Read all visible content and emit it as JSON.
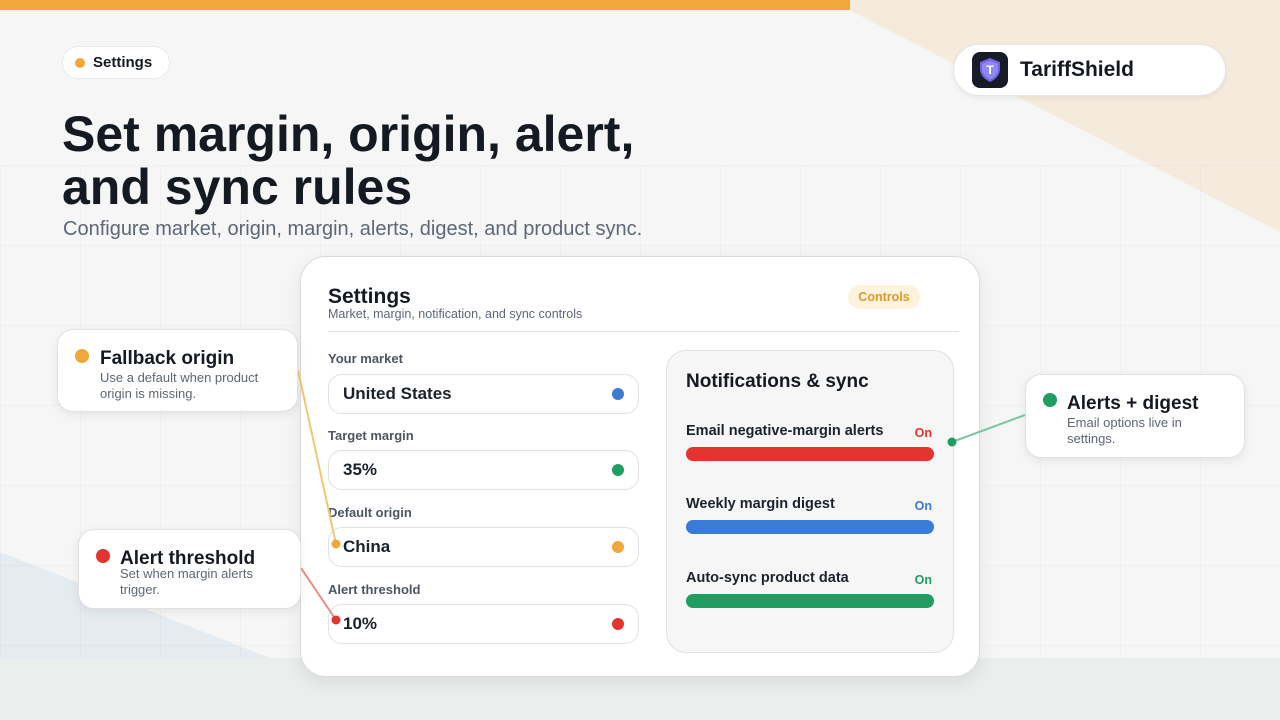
{
  "colors": {
    "accent_orange": "#f0a83a",
    "red": "#e3342f",
    "blue": "#3a7bd5",
    "green": "#1f9e63",
    "navy": "#161b26"
  },
  "tag": {
    "label": "Settings",
    "icon": "orange-dot-icon"
  },
  "brand": {
    "name": "TariffShield",
    "logo_icon": "shield-t-logo-icon",
    "logo_letter": "T"
  },
  "headline": {
    "line1": "Set margin, origin, alert,",
    "line2": "and sync rules"
  },
  "subheadline": "Configure market, origin, margin, alerts, digest, and product sync.",
  "panel": {
    "title": "Settings",
    "subtitle": "Market, margin, notification, and sync controls",
    "badge": "Controls",
    "fields": [
      {
        "label": "Your market",
        "value": "United States",
        "dot_color": "#3a7bd5"
      },
      {
        "label": "Target margin",
        "value": "35%",
        "dot_color": "#1f9e63"
      },
      {
        "label": "Default origin",
        "value": "China",
        "dot_color": "#f0a83a"
      },
      {
        "label": "Alert threshold",
        "value": "10%",
        "dot_color": "#e3342f"
      }
    ],
    "notifications": {
      "title": "Notifications & sync",
      "items": [
        {
          "label": "Email negative-margin alerts",
          "state": "On",
          "color": "#e3342f"
        },
        {
          "label": "Weekly margin digest",
          "state": "On",
          "color": "#3a7bd5"
        },
        {
          "label": "Auto-sync product data",
          "state": "On",
          "color": "#1f9e63"
        }
      ]
    }
  },
  "callouts": {
    "fallback": {
      "title": "Fallback origin",
      "text": "Use a default when product origin is missing.",
      "color": "#f0a83a"
    },
    "threshold": {
      "title": "Alert threshold",
      "text": "Set when margin alerts trigger.",
      "color": "#e3342f"
    },
    "alerts": {
      "title": "Alerts + digest",
      "text": "Email options live in settings.",
      "color": "#1f9e63"
    }
  }
}
